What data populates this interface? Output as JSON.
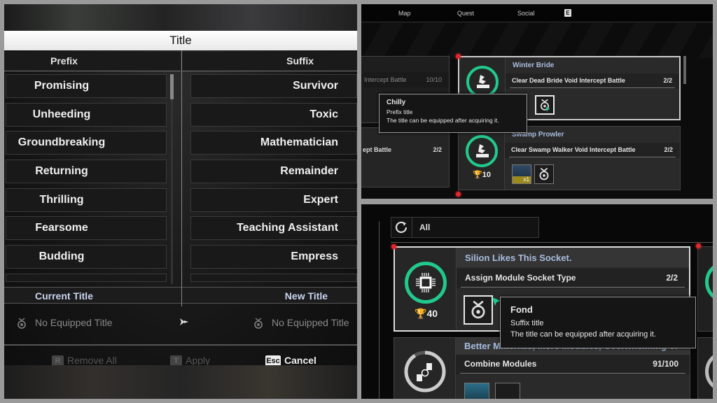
{
  "title_dialog": {
    "title": "Title",
    "prefix_header": "Prefix",
    "suffix_header": "Suffix",
    "prefixes": [
      "Promising",
      "Unheeding",
      "Groundbreaking",
      "Returning",
      "Thrilling",
      "Fearsome",
      "Budding"
    ],
    "suffixes": [
      "Survivor",
      "Toxic",
      "Mathematician",
      "Remainder",
      "Expert",
      "Teaching Assistant",
      "Empress"
    ],
    "current_title_header": "Current Title",
    "new_title_header": "New Title",
    "current_title_value": "No Equipped Title",
    "new_title_value": "No Equipped Title",
    "actions": {
      "remove_key": "R",
      "remove_label": "Remove All",
      "apply_key": "T",
      "apply_label": "Apply",
      "cancel_key": "Esc",
      "cancel_label": "Cancel"
    }
  },
  "challenges_top": {
    "nav": [
      "Map",
      "Quest",
      "Social"
    ],
    "nav_key": "E",
    "left_cards": [
      {
        "task": "Intercept Battle",
        "count": "10/10"
      },
      {
        "task": "ept Battle",
        "count": "2/2"
      }
    ],
    "cards": [
      {
        "title": "Winter Bride",
        "task": "Clear Dead Bride Void Intercept Battle",
        "count": "2/2"
      },
      {
        "title": "Swamp Prowler",
        "task": "Clear Swamp Walker Void Intercept Battle",
        "count": "2/2",
        "trophy": "10",
        "item_qty": "x1"
      }
    ],
    "tooltip": {
      "name": "Chilly",
      "type": "Prefix title",
      "desc": "The title can be equipped after acquiring it."
    }
  },
  "challenges_bottom": {
    "filter_label": "All",
    "cards": [
      {
        "title": "Silion Likes This Socket.",
        "task": "Assign Module Socket Type",
        "count": "2/2",
        "trophy": "40",
        "progress": 1.0
      },
      {
        "title": "Better Materials, More Modules, Overwhelming Vi",
        "task": "Combine Modules",
        "count": "91/100",
        "progress": 0.91
      }
    ],
    "tooltip": {
      "name": "Fond",
      "type": "Suffix title",
      "desc": "The title can be equipped after acquiring it."
    }
  },
  "colors": {
    "accent_green": "#22c98c",
    "title_blue": "#a9bde0",
    "alert_red": "#e2262e"
  }
}
